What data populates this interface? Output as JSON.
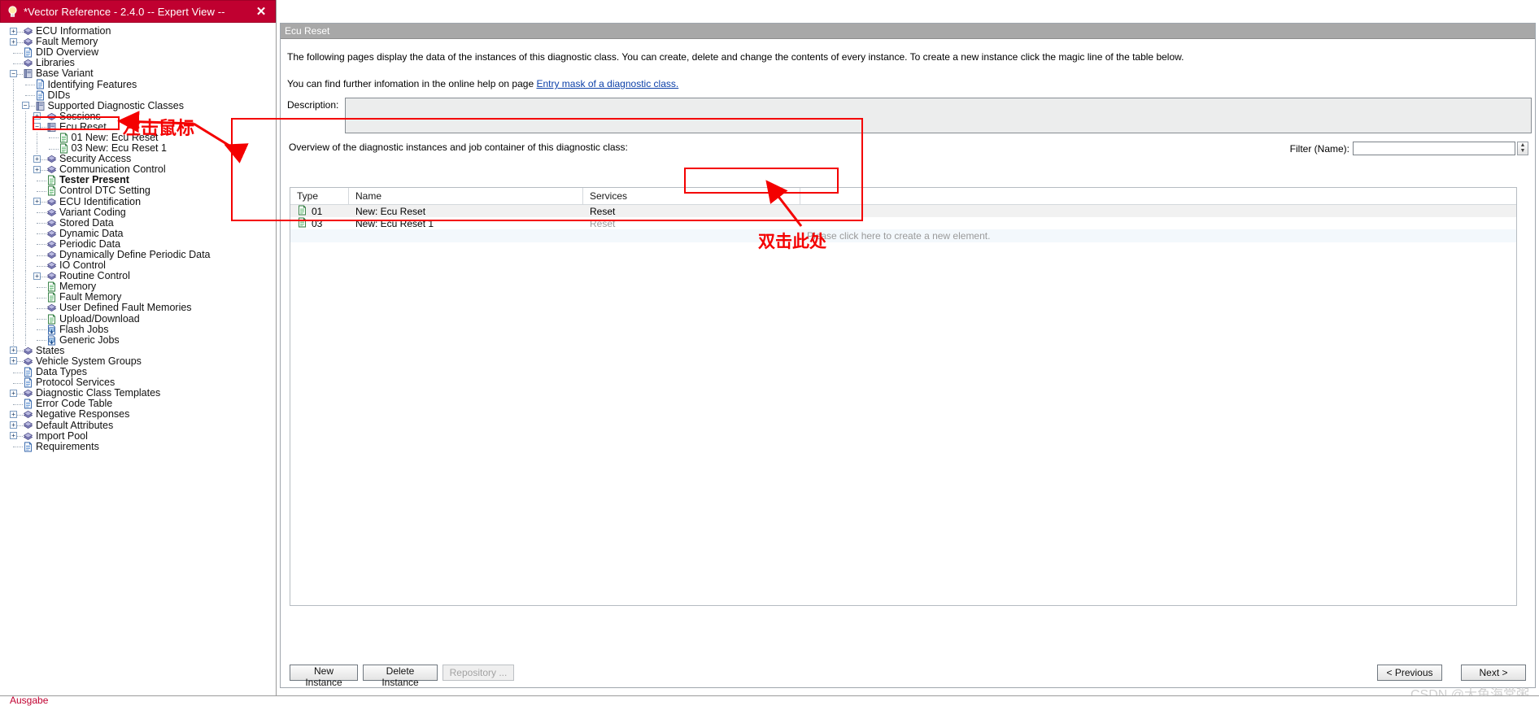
{
  "window": {
    "title": "*Vector Reference - 2.4.0 -- Expert View --",
    "close_label": "✕",
    "bulb_icon": "bulb-icon"
  },
  "tree": {
    "items": [
      {
        "label": "ECU Information",
        "depth": 0,
        "icon": "books",
        "expander": "+",
        "bold": false
      },
      {
        "label": "Fault Memory",
        "depth": 0,
        "icon": "books",
        "expander": "+",
        "bold": false
      },
      {
        "label": "DID Overview",
        "depth": 0,
        "icon": "page",
        "expander": "",
        "bold": false
      },
      {
        "label": "Libraries",
        "depth": 0,
        "icon": "books",
        "expander": "",
        "bold": false
      },
      {
        "label": "Base Variant",
        "depth": 0,
        "icon": "folder",
        "expander": "−",
        "bold": false
      },
      {
        "label": "Identifying Features",
        "depth": 1,
        "icon": "page",
        "expander": "",
        "bold": false
      },
      {
        "label": "DIDs",
        "depth": 1,
        "icon": "page",
        "expander": "",
        "bold": false
      },
      {
        "label": "Supported Diagnostic Classes",
        "depth": 1,
        "icon": "folder",
        "expander": "−",
        "bold": false
      },
      {
        "label": "Sessions",
        "depth": 2,
        "icon": "books",
        "expander": "+",
        "bold": false
      },
      {
        "label": "Ecu Reset",
        "depth": 2,
        "icon": "folder",
        "expander": "−",
        "bold": false,
        "selected": true
      },
      {
        "label": "01 New: Ecu Reset",
        "depth": 3,
        "icon": "greenpage",
        "expander": "",
        "bold": false
      },
      {
        "label": "03 New: Ecu Reset 1",
        "depth": 3,
        "icon": "greenpage",
        "expander": "",
        "bold": false
      },
      {
        "label": "Security Access",
        "depth": 2,
        "icon": "books",
        "expander": "+",
        "bold": false
      },
      {
        "label": "Communication Control",
        "depth": 2,
        "icon": "books",
        "expander": "+",
        "bold": false
      },
      {
        "label": "Tester Present",
        "depth": 2,
        "icon": "greenpage",
        "expander": "",
        "bold": true
      },
      {
        "label": "Control DTC Setting",
        "depth": 2,
        "icon": "greenpage",
        "expander": "",
        "bold": false
      },
      {
        "label": "ECU Identification",
        "depth": 2,
        "icon": "books",
        "expander": "+",
        "bold": false
      },
      {
        "label": "Variant Coding",
        "depth": 2,
        "icon": "books",
        "expander": "",
        "bold": false
      },
      {
        "label": "Stored Data",
        "depth": 2,
        "icon": "books",
        "expander": "",
        "bold": false
      },
      {
        "label": "Dynamic Data",
        "depth": 2,
        "icon": "books",
        "expander": "",
        "bold": false
      },
      {
        "label": "Periodic Data",
        "depth": 2,
        "icon": "books",
        "expander": "",
        "bold": false
      },
      {
        "label": "Dynamically Define Periodic Data",
        "depth": 2,
        "icon": "books",
        "expander": "",
        "bold": false
      },
      {
        "label": "IO Control",
        "depth": 2,
        "icon": "books",
        "expander": "",
        "bold": false
      },
      {
        "label": "Routine Control",
        "depth": 2,
        "icon": "books",
        "expander": "+",
        "bold": false
      },
      {
        "label": "Memory",
        "depth": 2,
        "icon": "greenpage",
        "expander": "",
        "bold": false
      },
      {
        "label": "Fault Memory",
        "depth": 2,
        "icon": "greenpage",
        "expander": "",
        "bold": false
      },
      {
        "label": "User Defined Fault Memories",
        "depth": 2,
        "icon": "books",
        "expander": "",
        "bold": false
      },
      {
        "label": "Upload/Download",
        "depth": 2,
        "icon": "greenpage",
        "expander": "",
        "bold": false
      },
      {
        "label": "Flash Jobs",
        "depth": 2,
        "icon": "jobs",
        "expander": "",
        "bold": false
      },
      {
        "label": "Generic Jobs",
        "depth": 2,
        "icon": "jobs",
        "expander": "",
        "bold": false
      },
      {
        "label": "States",
        "depth": 0,
        "icon": "books",
        "expander": "+",
        "bold": false
      },
      {
        "label": "Vehicle System Groups",
        "depth": 0,
        "icon": "books",
        "expander": "+",
        "bold": false
      },
      {
        "label": "Data Types",
        "depth": 0,
        "icon": "page",
        "expander": "",
        "bold": false
      },
      {
        "label": "Protocol Services",
        "depth": 0,
        "icon": "page",
        "expander": "",
        "bold": false
      },
      {
        "label": "Diagnostic Class Templates",
        "depth": 0,
        "icon": "books",
        "expander": "+",
        "bold": false
      },
      {
        "label": "Error Code Table",
        "depth": 0,
        "icon": "page",
        "expander": "",
        "bold": false
      },
      {
        "label": "Negative Responses",
        "depth": 0,
        "icon": "books",
        "expander": "+",
        "bold": false
      },
      {
        "label": "Default Attributes",
        "depth": 0,
        "icon": "books",
        "expander": "+",
        "bold": false
      },
      {
        "label": "Import Pool",
        "depth": 0,
        "icon": "books",
        "expander": "+",
        "bold": false
      },
      {
        "label": "Requirements",
        "depth": 0,
        "icon": "page",
        "expander": "",
        "bold": false
      }
    ]
  },
  "content": {
    "header_title": "Ecu Reset",
    "intro_line1": "The following pages display the data of the instances of this diagnostic class. You can create, delete and change the contents of every instance. To create a new instance click the magic line of the table below.",
    "intro_line2_pre": "You can find further infomation in the online help on page",
    "intro_link": "Entry mask of a diagnostic class.",
    "description_label": "Description:",
    "description_value": "",
    "overview_label": "Overview of the diagnostic instances and job container of this diagnostic class:",
    "filter_label": "Filter (Name):",
    "filter_value": "",
    "filter_placeholder": ""
  },
  "table": {
    "columns": [
      "Type",
      "Name",
      "Services",
      ""
    ],
    "rows": [
      {
        "type": "01",
        "name": "New: Ecu Reset",
        "services": "Reset",
        "services_dim": false
      },
      {
        "type": "03",
        "name": "New: Ecu Reset 1",
        "services": "Reset",
        "services_dim": true
      }
    ],
    "magic_line_text": "Please click here to create a new element."
  },
  "buttons": {
    "new_instance": "New Instance",
    "delete_instance": "Delete Instance",
    "repository": "Repository ...",
    "previous": "< Previous",
    "next": "Next >"
  },
  "annotations": {
    "left_click_mouse": "左击鼠标",
    "double_click_here": "双击此处",
    "accent_color": "#f40000"
  },
  "statusbar": {
    "output_label": "Ausgabe"
  },
  "watermark": {
    "text": "CSDN @大鱼海棠粥"
  },
  "colors": {
    "title_bar": "#c00030",
    "page_header": "#a8a8a8",
    "link": "#0b3fa8",
    "annotation": "#f40000"
  }
}
